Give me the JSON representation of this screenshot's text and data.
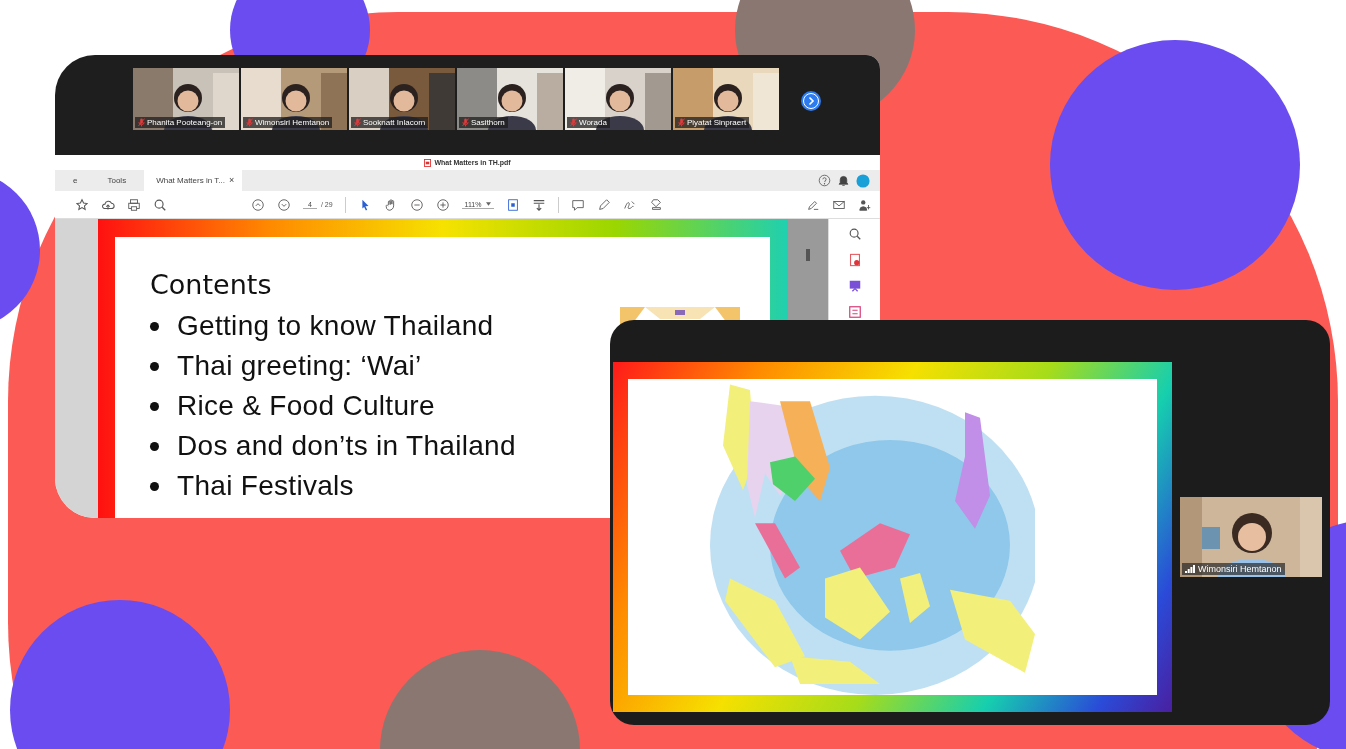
{
  "meeting_window": {
    "participants": [
      {
        "name": "Phanita Pooteang-on",
        "muted": true
      },
      {
        "name": "Wimonsiri Hemtanon",
        "muted": true
      },
      {
        "name": "Sooknatt Inlacorn",
        "muted": true
      },
      {
        "name": "Sasithorn",
        "muted": true
      },
      {
        "name": "Worada",
        "muted": true
      },
      {
        "name": "Piyatat Sinpraert",
        "muted": true
      }
    ],
    "document_title": "What Matters in TH.pdf",
    "tabs": [
      {
        "label": "e",
        "selected": false
      },
      {
        "label": "Tools",
        "selected": false
      },
      {
        "label": "What Matters in T...",
        "selected": true
      }
    ],
    "document_tab_close": "×",
    "page_number": "4",
    "page_count": "/ 29",
    "zoom": "111%",
    "slide": {
      "heading": "Contents",
      "bullets": [
        "Getting to know Thailand",
        "Thai greeting:  ‘Wai’",
        "Rice & Food Culture",
        "Dos and don’ts in Thailand",
        "Thai Festivals"
      ]
    }
  },
  "share_window": {
    "speaker": {
      "name": "Wimonsiri Hemtanon"
    }
  }
}
